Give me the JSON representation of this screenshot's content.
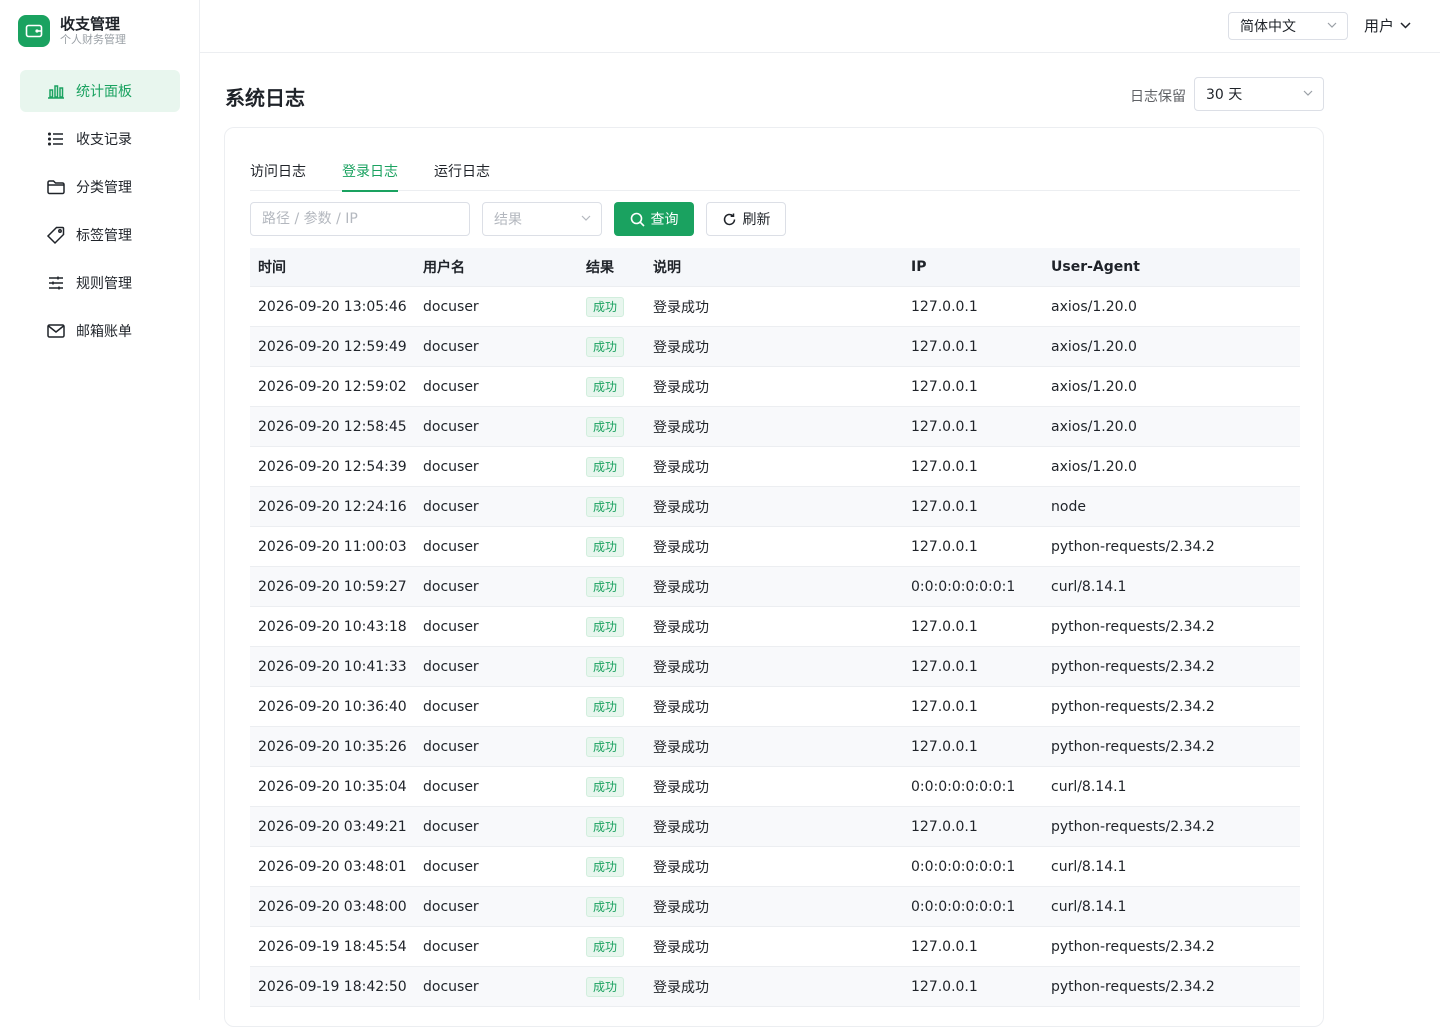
{
  "brand": {
    "title": "收支管理",
    "subtitle": "个人财务管理"
  },
  "sidebar": {
    "items": [
      {
        "label": "统计面板",
        "icon": "bar-chart-icon",
        "active": true
      },
      {
        "label": "收支记录",
        "icon": "list-icon"
      },
      {
        "label": "分类管理",
        "icon": "folder-icon"
      },
      {
        "label": "标签管理",
        "icon": "tag-icon"
      },
      {
        "label": "规则管理",
        "icon": "sliders-icon"
      },
      {
        "label": "邮箱账单",
        "icon": "mail-icon"
      }
    ]
  },
  "header": {
    "language": "简体中文",
    "user": "用户"
  },
  "page": {
    "title": "系统日志",
    "retention_label": "日志保留",
    "retention_value": "30 天"
  },
  "tabs": [
    {
      "label": "访问日志",
      "active": false
    },
    {
      "label": "登录日志",
      "active": true
    },
    {
      "label": "运行日志",
      "active": false
    }
  ],
  "filters": {
    "search_placeholder": "路径 / 参数 / IP",
    "result_placeholder": "结果",
    "query_label": "查询",
    "refresh_label": "刷新"
  },
  "colors": {
    "accent": "#1aa260",
    "accent_bg": "#e8f6ee"
  },
  "table": {
    "headers": [
      "时间",
      "用户名",
      "结果",
      "说明",
      "IP",
      "User-Agent"
    ],
    "rows": [
      [
        "2026-09-20 13:05:46",
        "docuser",
        "成功",
        "登录成功",
        "127.0.0.1",
        "axios/1.20.0"
      ],
      [
        "2026-09-20 12:59:49",
        "docuser",
        "成功",
        "登录成功",
        "127.0.0.1",
        "axios/1.20.0"
      ],
      [
        "2026-09-20 12:59:02",
        "docuser",
        "成功",
        "登录成功",
        "127.0.0.1",
        "axios/1.20.0"
      ],
      [
        "2026-09-20 12:58:45",
        "docuser",
        "成功",
        "登录成功",
        "127.0.0.1",
        "axios/1.20.0"
      ],
      [
        "2026-09-20 12:54:39",
        "docuser",
        "成功",
        "登录成功",
        "127.0.0.1",
        "axios/1.20.0"
      ],
      [
        "2026-09-20 12:24:16",
        "docuser",
        "成功",
        "登录成功",
        "127.0.0.1",
        "node"
      ],
      [
        "2026-09-20 11:00:03",
        "docuser",
        "成功",
        "登录成功",
        "127.0.0.1",
        "python-requests/2.34.2"
      ],
      [
        "2026-09-20 10:59:27",
        "docuser",
        "成功",
        "登录成功",
        "0:0:0:0:0:0:0:1",
        "curl/8.14.1"
      ],
      [
        "2026-09-20 10:43:18",
        "docuser",
        "成功",
        "登录成功",
        "127.0.0.1",
        "python-requests/2.34.2"
      ],
      [
        "2026-09-20 10:41:33",
        "docuser",
        "成功",
        "登录成功",
        "127.0.0.1",
        "python-requests/2.34.2"
      ],
      [
        "2026-09-20 10:36:40",
        "docuser",
        "成功",
        "登录成功",
        "127.0.0.1",
        "python-requests/2.34.2"
      ],
      [
        "2026-09-20 10:35:26",
        "docuser",
        "成功",
        "登录成功",
        "127.0.0.1",
        "python-requests/2.34.2"
      ],
      [
        "2026-09-20 10:35:04",
        "docuser",
        "成功",
        "登录成功",
        "0:0:0:0:0:0:0:1",
        "curl/8.14.1"
      ],
      [
        "2026-09-20 03:49:21",
        "docuser",
        "成功",
        "登录成功",
        "127.0.0.1",
        "python-requests/2.34.2"
      ],
      [
        "2026-09-20 03:48:01",
        "docuser",
        "成功",
        "登录成功",
        "0:0:0:0:0:0:0:1",
        "curl/8.14.1"
      ],
      [
        "2026-09-20 03:48:00",
        "docuser",
        "成功",
        "登录成功",
        "0:0:0:0:0:0:0:1",
        "curl/8.14.1"
      ],
      [
        "2026-09-19 18:45:54",
        "docuser",
        "成功",
        "登录成功",
        "127.0.0.1",
        "python-requests/2.34.2"
      ],
      [
        "2026-09-19 18:42:50",
        "docuser",
        "成功",
        "登录成功",
        "127.0.0.1",
        "python-requests/2.34.2"
      ]
    ]
  }
}
